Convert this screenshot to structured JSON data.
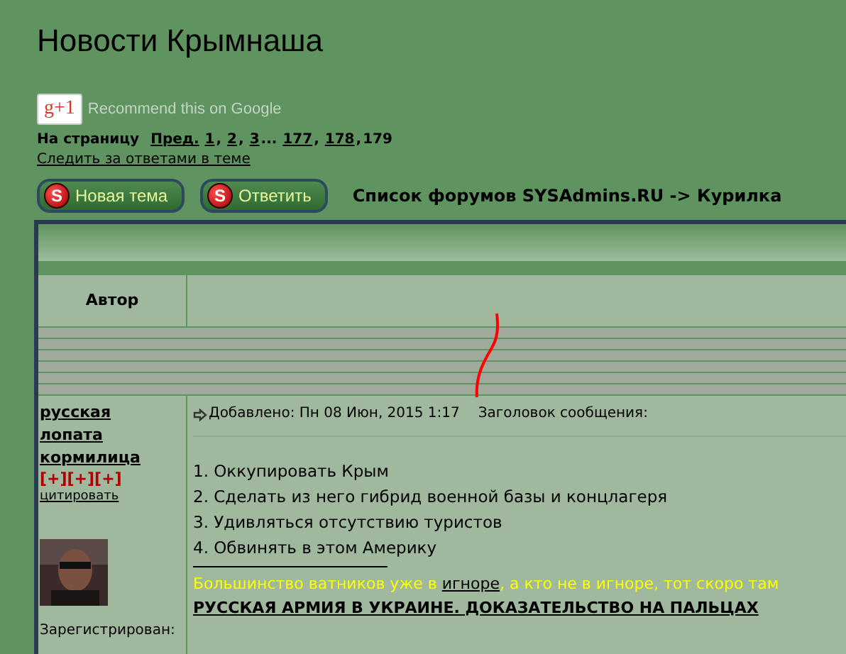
{
  "page_title": "Новости Крымнаша",
  "google": {
    "button": "g+1",
    "label": "Recommend this on Google"
  },
  "pagination": {
    "prefix": "На страницу",
    "items": [
      {
        "kind": "link",
        "label": "Пред."
      },
      {
        "kind": "link",
        "label": "1"
      },
      {
        "kind": "text",
        "label": ","
      },
      {
        "kind": "link",
        "label": "2"
      },
      {
        "kind": "text",
        "label": ","
      },
      {
        "kind": "link",
        "label": "3"
      },
      {
        "kind": "text",
        "label": "..."
      },
      {
        "kind": "link",
        "label": "177"
      },
      {
        "kind": "text",
        "label": ","
      },
      {
        "kind": "link",
        "label": "178"
      },
      {
        "kind": "text",
        "label": ","
      },
      {
        "kind": "text",
        "label": "179"
      }
    ]
  },
  "follow_link": "Следить за ответами в теме",
  "buttons": [
    {
      "label": "Новая тема",
      "badge": "S"
    },
    {
      "label": "Ответить",
      "badge": "S"
    }
  ],
  "breadcrumb": "Список форумов SYSAdmins.RU -> Курилка",
  "table": {
    "columns": [
      "Автор"
    ]
  },
  "post": {
    "author": "русская лопата кормилица",
    "rating": "[+][+][+]",
    "quote_link": "цитировать",
    "registered": "Зарегистрирован:",
    "added": "Добавлено: Пн 08 Июн, 2015 1:17",
    "subject_label": "Заголовок сообщения:",
    "lines": [
      "1. Оккупировать Крым",
      "2. Сделать из него гибрид военной базы и концлагеря",
      "3. Удивляться отсутствию туристов",
      "4. Обвинять в этом Америку"
    ],
    "signature": {
      "before": "Большинство ватников уже в",
      "link": "игноре",
      "after": ", а кто не в игноре, тот скоро там"
    },
    "headline": "РУССКАЯ АРМИЯ В УКРАИНЕ. ДОКАЗАТЕЛЬСТВО НА ПАЛЬЦАХ"
  }
}
